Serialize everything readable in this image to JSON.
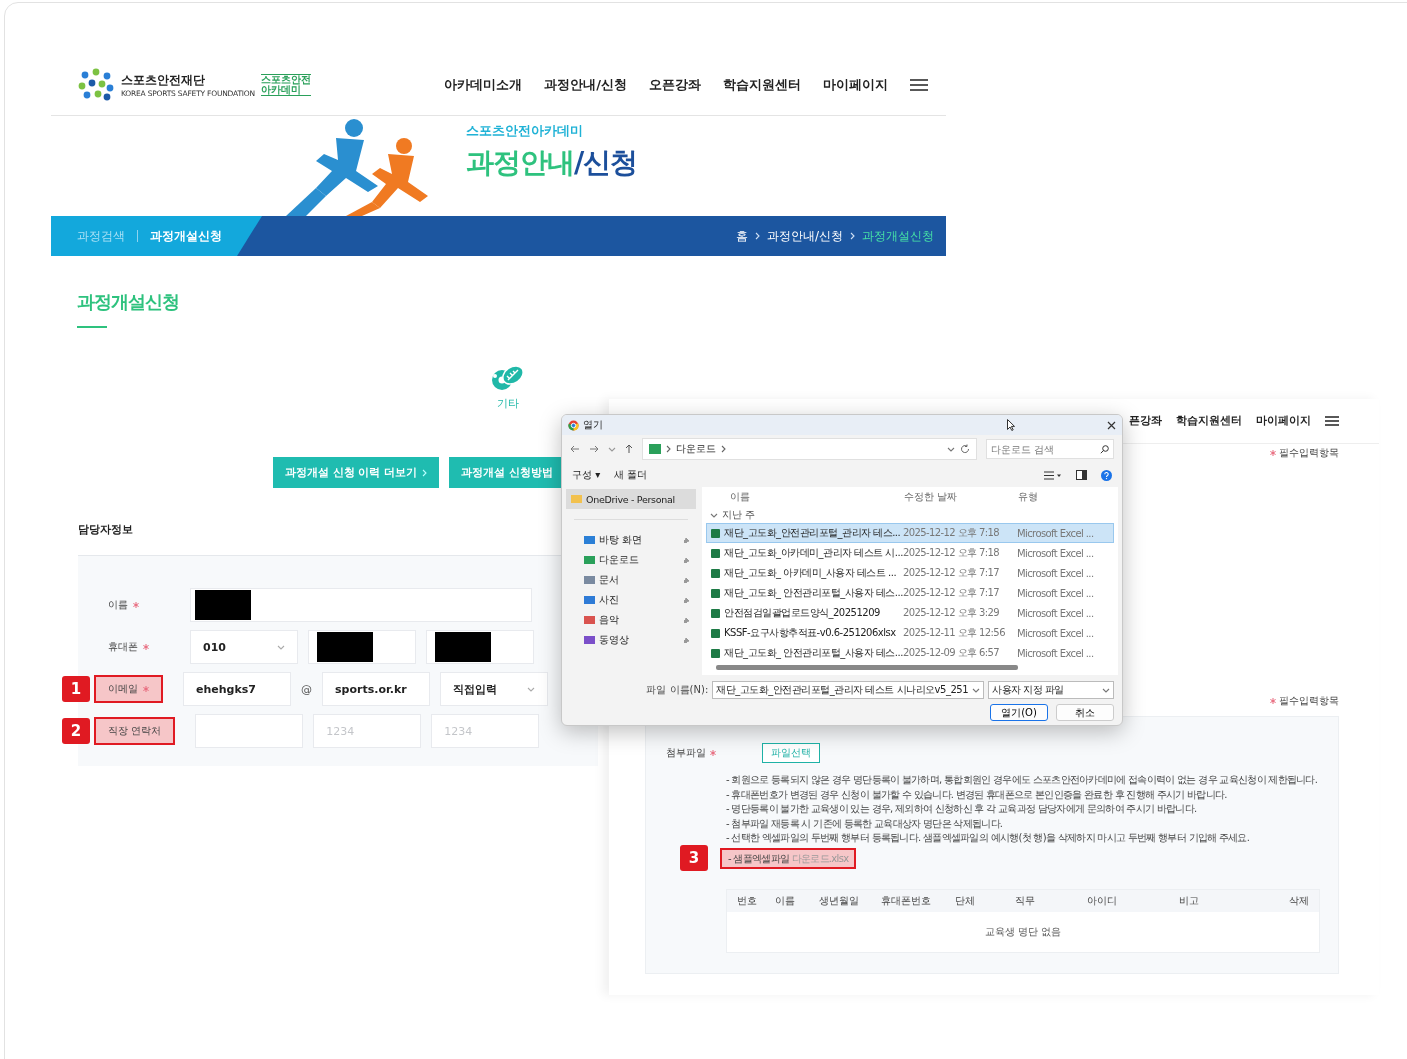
{
  "back_page": {
    "logo": {
      "name": "스포츠안전재단",
      "english": "KOREA SPORTS SAFETY FOUNDATION",
      "badge_lines": [
        "스포츠안전",
        "아카데미"
      ]
    },
    "nav": [
      "아카데미소개",
      "과정안내/신청",
      "오픈강좌",
      "학습지원센터",
      "마이페이지"
    ],
    "banner": {
      "subtitle": "스포츠안전아카데미",
      "title_highlight": "과정안내",
      "title_rest": "/신청"
    },
    "subnav": [
      {
        "label": "과정검색",
        "selected": false
      },
      {
        "label": "과정개설신청",
        "selected": true
      }
    ],
    "breadcrumb": [
      {
        "label": "홈",
        "current": false
      },
      {
        "label": "과정안내/신청",
        "current": false
      },
      {
        "label": "과정개설신청",
        "current": true
      }
    ],
    "page_title": "과정개설신청",
    "category": {
      "label": "기타"
    },
    "buttons": [
      "과정개설 신청 이력 더보기",
      "과정개설 신청방법"
    ],
    "section_title": "담당자정보",
    "form_rows": [
      {
        "label": "이름",
        "required": true,
        "fields": [
          {
            "kind": "redacted"
          }
        ]
      },
      {
        "label": "휴대폰",
        "required": true,
        "fields": [
          {
            "kind": "select",
            "value": "010"
          },
          {
            "kind": "redacted"
          },
          {
            "kind": "redacted"
          }
        ]
      },
      {
        "label": "이메일",
        "required": true,
        "marker": "1",
        "fields": [
          {
            "kind": "input",
            "value": "ehehgks7"
          },
          {
            "kind": "at",
            "value": "@"
          },
          {
            "kind": "input",
            "value": "sports.or.kr"
          },
          {
            "kind": "select",
            "value": "직접입력"
          }
        ]
      },
      {
        "label": "직장 연락처",
        "required": false,
        "marker": "2",
        "fields": [
          {
            "kind": "input"
          },
          {
            "kind": "input",
            "placeholder": "1234"
          },
          {
            "kind": "input",
            "placeholder": "1234"
          }
        ]
      }
    ]
  },
  "front_page": {
    "nav": [
      "픈강좌",
      "학습지원센터",
      "마이페이지"
    ],
    "required_notes": [
      "필수입력항목",
      "필수입력항목"
    ],
    "attach_label": "첨부파일",
    "attach_required": true,
    "attach_button": "파일선택",
    "notes": [
      "- 회원으로 등록되지 않은 경우 명단등록이 불가하며, 통합회원인 경우에도 스포츠안전아카데미에 접속이력이 없는 경우 교육신청이 제한됩니다.",
      "- 휴대폰번호가 변경된 경우 신청이 불가할 수 있습니다. 변경된 휴대폰으로 본인인증을 완료한 후 진행해 주시기 바랍니다.",
      "- 명단등록이 불가한 교육생이 있는 경우, 제외하여 신청하신 후 각 교육과정 담당자에게 문의하여 주시기 바랍니다.",
      "- 첨부파일 재등록 시 기존에 등록한 교육대상자 명단은 삭제됩니다.",
      "- 선택한 엑셀파일의 두번째 행부터 등록됩니다. 샘플엑셀파일의 예시행(첫 행)을 삭제하지 마시고 두번째 행부터 기입해 주세요."
    ],
    "sample": {
      "text": "- 샘플엑셀파일",
      "link": "다운로드.xlsx",
      "marker": "3"
    },
    "table": {
      "columns": [
        "번호",
        "이름",
        "생년월일",
        "휴대폰번호",
        "단체",
        "직무",
        "아이디",
        "비고",
        "삭제"
      ],
      "empty": "교육생 명단 없음"
    }
  },
  "dialog": {
    "title": "열기",
    "path": [
      "다운로드"
    ],
    "search_placeholder": "다운로드 검색",
    "toolbar": [
      "구성 ▾",
      "새 폴더"
    ],
    "sidebar": [
      {
        "label": "OneDrive - Personal",
        "kind": "cloud",
        "selected": true
      },
      {
        "label": "바탕 화면",
        "kind": "desktop",
        "selected": false
      },
      {
        "label": "다운로드",
        "kind": "download",
        "selected": false
      },
      {
        "label": "문서",
        "kind": "docs",
        "selected": false
      },
      {
        "label": "사진",
        "kind": "pictures",
        "selected": false
      },
      {
        "label": "음악",
        "kind": "music",
        "selected": false
      },
      {
        "label": "동영상",
        "kind": "videos",
        "selected": false
      }
    ],
    "columns": [
      "이름",
      "수정한 날짜",
      "유형"
    ],
    "group": "지난 주",
    "files": [
      {
        "name": "재단_고도화_안전관리포털_관리자 테스...",
        "date": "2025-12-12 오후 7:18",
        "type": "Microsoft Excel ...",
        "selected": true
      },
      {
        "name": "재단_고도화_아카데미_관리자 테스트 시...",
        "date": "2025-12-12 오후 7:18",
        "type": "Microsoft Excel ...",
        "selected": false
      },
      {
        "name": "재단_고도화_ 아카데미_사용자 테스트 ...",
        "date": "2025-12-12 오후 7:17",
        "type": "Microsoft Excel ...",
        "selected": false
      },
      {
        "name": "재단_고도화_ 안전관리포털_사용자 테스...",
        "date": "2025-12-12 오후 7:17",
        "type": "Microsoft Excel ...",
        "selected": false
      },
      {
        "name": "안전점검일괄업로드양식_20251209",
        "date": "2025-12-12 오후 3:29",
        "type": "Microsoft Excel ...",
        "selected": false
      },
      {
        "name": "KSSF-요구사항추적표-v0.6-251206xlsx",
        "date": "2025-12-11 오후 12:56",
        "type": "Microsoft Excel ...",
        "selected": false
      },
      {
        "name": "재단_고도화_ 안전관리포털_사용자 테스...",
        "date": "2025-12-09 오후 6:57",
        "type": "Microsoft Excel ...",
        "selected": false
      }
    ],
    "filename_label": "파일 이름(N):",
    "filename": "재단_고도화_안전관리포털_관리자 테스트 시나리오v5_251",
    "filetype": "사용자 지정 파일",
    "buttons": [
      "열기(O)",
      "취소"
    ]
  }
}
